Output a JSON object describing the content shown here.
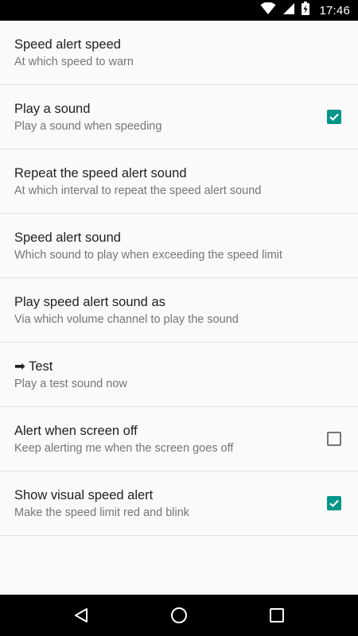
{
  "status_bar": {
    "time": "17:46",
    "icons": [
      "wifi-icon",
      "signal-icon",
      "battery-charging-icon"
    ]
  },
  "preferences": [
    {
      "title": "Speed alert speed",
      "summary": "At which speed to warn",
      "has_checkbox": false
    },
    {
      "title": "Play a sound",
      "summary": "Play a sound when speeding",
      "has_checkbox": true,
      "checked": true
    },
    {
      "title": "Repeat the speed alert sound",
      "summary": "At which interval to repeat the speed alert sound",
      "has_checkbox": false
    },
    {
      "title": "Speed alert sound",
      "summary": "Which sound to play when exceeding the speed limit",
      "has_checkbox": false
    },
    {
      "title": "Play speed alert sound as",
      "summary": "Via which volume channel to play the sound",
      "has_checkbox": false
    },
    {
      "title": "➡ Test",
      "summary": "Play a test sound now",
      "has_checkbox": false
    },
    {
      "title": "Alert when screen off",
      "summary": "Keep alerting me when the screen goes off",
      "has_checkbox": true,
      "checked": false
    },
    {
      "title": "Show visual speed alert",
      "summary": "Make the speed limit red and blink",
      "has_checkbox": true,
      "checked": true
    }
  ],
  "nav_bar": {
    "icons": [
      "back-icon",
      "home-icon",
      "recents-icon"
    ]
  },
  "colors": {
    "accent": "#009688",
    "background": "#fafafa",
    "divider": "#e0e0e0",
    "title_text": "#212121",
    "summary_text": "#757575"
  }
}
